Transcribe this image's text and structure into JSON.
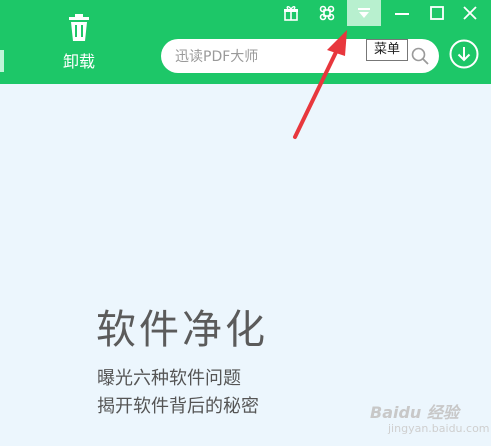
{
  "toolbar": {
    "uninstall_label": "卸载"
  },
  "window_controls": {
    "gift_icon": "gift-icon",
    "skin_icon": "skin-icon",
    "menu_icon": "menu-icon",
    "minimize_icon": "minimize-icon",
    "maximize_icon": "maximize-icon",
    "close_icon": "close-icon"
  },
  "search": {
    "placeholder": "迅读PDF大师"
  },
  "tooltip": {
    "text": "菜单"
  },
  "hero": {
    "title": "软件净化",
    "line1": "曝光六种软件问题",
    "line2": "揭开软件背后的秘密"
  },
  "watermark": {
    "text": "Baidu 经验",
    "sub": "jingyan.baidu.com"
  },
  "colors": {
    "header": "#1dc768",
    "content_bg": "#ecf6fd",
    "arrow": "#e8373d"
  }
}
